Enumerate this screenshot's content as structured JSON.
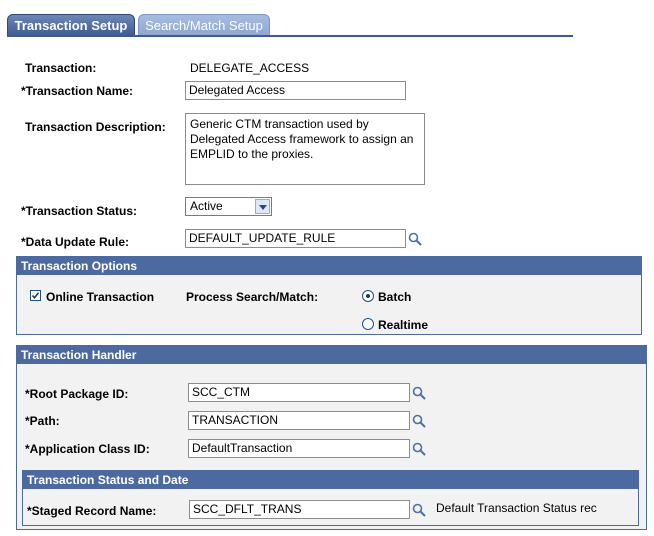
{
  "tabs": {
    "active": "Transaction Setup",
    "inactive": "Search/Match Setup"
  },
  "transaction": {
    "label": "Transaction:",
    "value": "DELEGATE_ACCESS"
  },
  "transaction_name": {
    "label": "*Transaction Name:",
    "value": "Delegated Access"
  },
  "transaction_description": {
    "label": "Transaction Description:",
    "value": "Generic CTM transaction used by Delegated Access framework to assign an EMPLID to the proxies."
  },
  "transaction_status": {
    "label": "*Transaction Status:",
    "value": "Active"
  },
  "data_update_rule": {
    "label": "*Data Update Rule:",
    "value": "DEFAULT_UPDATE_RULE"
  },
  "transaction_options": {
    "title": "Transaction Options",
    "online_transaction_label": "Online Transaction",
    "online_transaction_checked": true,
    "process_label": "Process Search/Match:",
    "batch_label": "Batch",
    "realtime_label": "Realtime",
    "selected": "Batch"
  },
  "transaction_handler": {
    "title": "Transaction Handler",
    "root_package_label": "*Root Package ID:",
    "root_package_value": "SCC_CTM",
    "path_label": "*Path:",
    "path_value": "TRANSACTION",
    "app_class_label": "*Application Class ID:",
    "app_class_value": "DefaultTransaction"
  },
  "status_and_date": {
    "title": "Transaction Status and Date",
    "staged_label": "*Staged Record Name:",
    "staged_value": "SCC_DFLT_TRANS",
    "staged_description": "Default Transaction Status rec"
  },
  "colors": {
    "header_blue": "#4d6aa0",
    "tab_active": "#3e5a93",
    "tab_inactive": "#8ea6d1"
  }
}
